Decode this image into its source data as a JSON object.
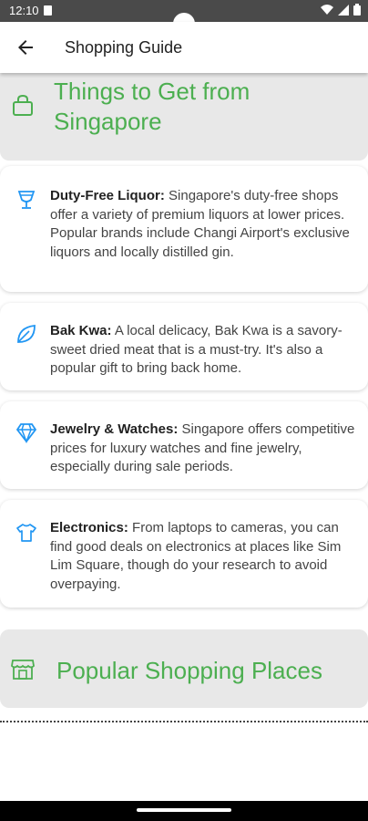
{
  "status_bar": {
    "time": "12:10"
  },
  "app_bar": {
    "title": "Shopping Guide"
  },
  "sections": {
    "things_header": {
      "line1": "Things to Get from",
      "line2": "Singapore"
    },
    "items": [
      {
        "icon": "glass-icon",
        "title": "Duty-Free Liquor:",
        "text": " Singapore's duty-free shops offer a variety of premium liquors at lower prices. Popular brands include Changi Airport's exclusive liquors and locally distilled gin."
      },
      {
        "icon": "leaf-icon",
        "title": "Bak Kwa:",
        "text": " A local delicacy, Bak Kwa is a savory-sweet dried meat that is a must-try. It's also a popular gift to bring back home."
      },
      {
        "icon": "diamond-icon",
        "title": "Jewelry & Watches:",
        "text": " Singapore offers competitive prices for luxury watches and fine jewelry, especially during sale periods."
      },
      {
        "icon": "tshirt-icon",
        "title": "Electronics:",
        "text": " From laptops to cameras, you can find good deals on electronics at places like Sim Lim Square, though do your research to avoid overpaying."
      }
    ],
    "places_header": {
      "title": "Popular Shopping Places"
    }
  },
  "colors": {
    "accent": "#4caf50",
    "icon_blue": "#2196f3",
    "header_bg": "#e8e8e8"
  }
}
